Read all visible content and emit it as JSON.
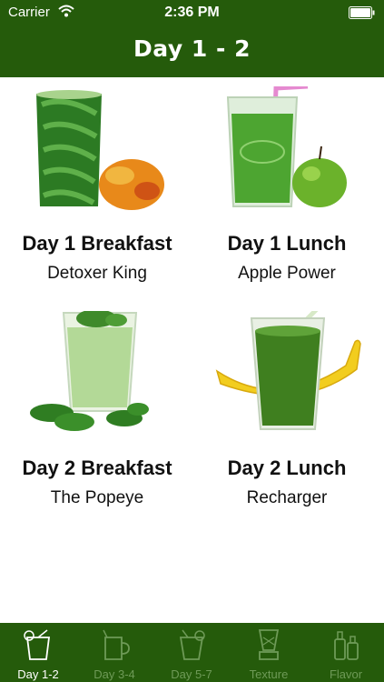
{
  "status_bar": {
    "carrier": "Carrier",
    "time": "2:36 PM"
  },
  "nav": {
    "title": "Day 1 - 2"
  },
  "cards": [
    {
      "day": "Day 1 Breakfast",
      "name": "Detoxer King"
    },
    {
      "day": "Day 1 Lunch",
      "name": "Apple Power"
    },
    {
      "day": "Day 2 Breakfast",
      "name": "The Popeye"
    },
    {
      "day": "Day 2 Lunch",
      "name": "Recharger"
    }
  ],
  "tabs": [
    {
      "label": "Day 1-2",
      "icon": "cocktail-glass-icon",
      "active": true
    },
    {
      "label": "Day 3-4",
      "icon": "mug-icon",
      "active": false
    },
    {
      "label": "Day 5-7",
      "icon": "cocktail-glass-icon",
      "active": false
    },
    {
      "label": "Texture",
      "icon": "blender-icon",
      "active": false
    },
    {
      "label": "Flavor",
      "icon": "bottles-icon",
      "active": false
    }
  ],
  "colors": {
    "bar": "#255b0b",
    "inactive_tab": "#6e9a57",
    "active_tab": "#ffffff"
  }
}
